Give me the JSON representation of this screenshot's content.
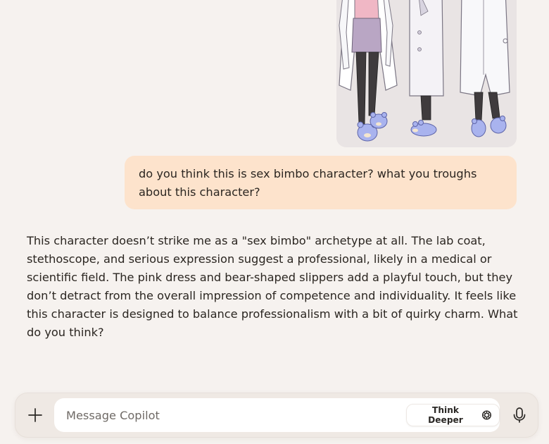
{
  "conversation": {
    "attached_image": {
      "alt": "Character turnaround sheet",
      "icon": "image-thumbnail"
    },
    "user_message": {
      "text": "do you think this is sex bimbo character? what you troughs about this character?"
    },
    "assistant_message": {
      "text": "This character doesn’t strike me as a \"sex bimbo\" archetype at all. The lab coat, stethoscope, and serious expression suggest a professional, likely in a medical or scientific field. The pink dress and bear-shaped slippers add a playful touch, but they don’t detract from the overall impression of competence and individuality. It feels like this character is designed to balance professionalism with a bit of quirky charm. What do you think?"
    }
  },
  "composer": {
    "placeholder": "Message Copilot",
    "value": "",
    "think_deeper_label": "Think Deeper",
    "icons": {
      "add": "plus-icon",
      "think": "sparkle-icon",
      "voice": "microphone-icon"
    }
  },
  "colors": {
    "page_background": "#f6f2ef",
    "user_bubble": "#fde3cc",
    "input_background": "#ffffff",
    "text": "#2b2621"
  }
}
